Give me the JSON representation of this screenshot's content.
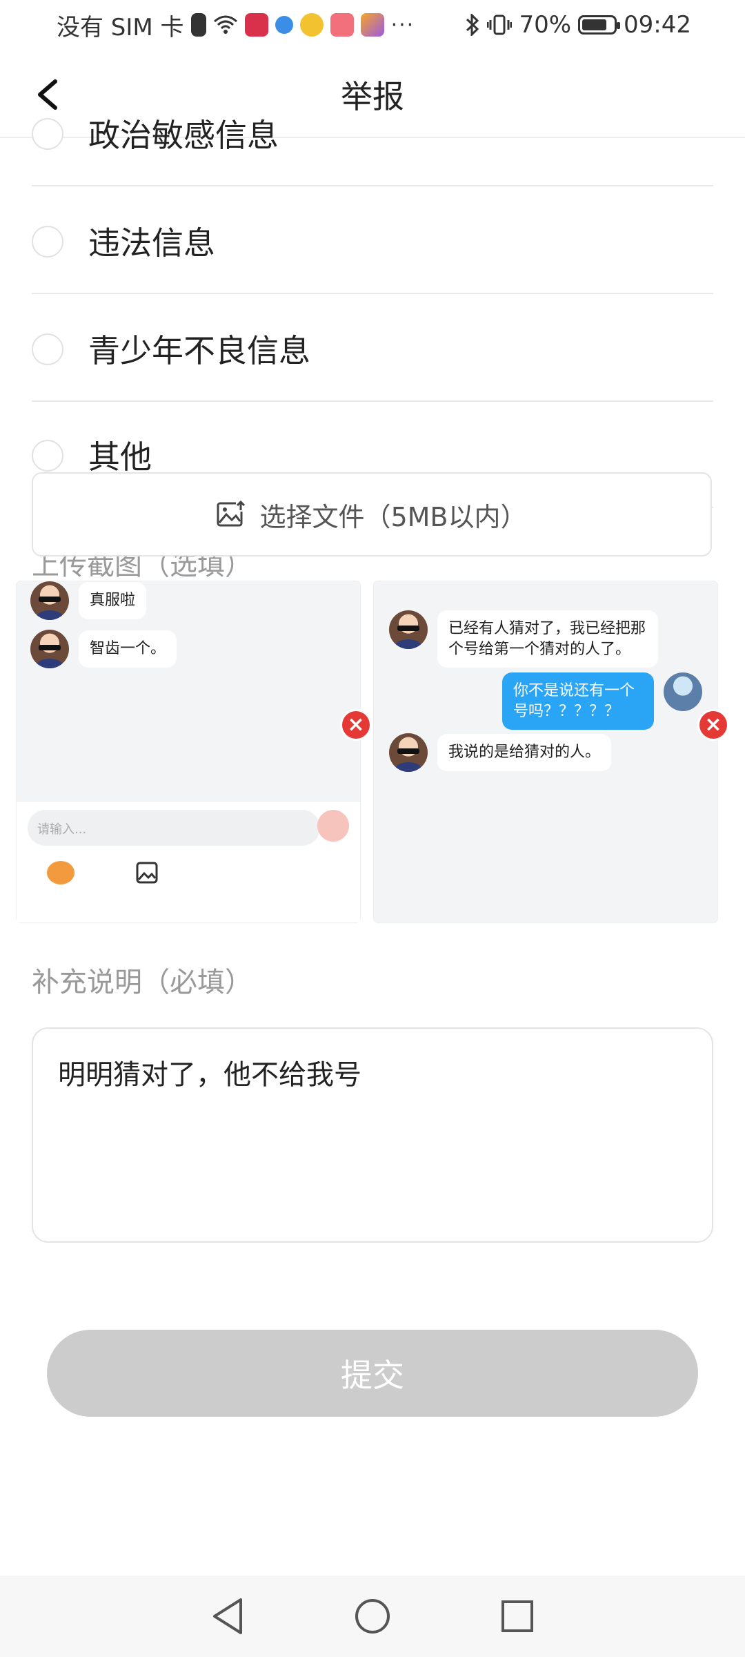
{
  "status_bar": {
    "carrier": "没有 SIM 卡",
    "more": "···",
    "battery": "70%",
    "time": "09:42"
  },
  "header": {
    "title": "举报"
  },
  "options": [
    {
      "label": "政治敏感信息"
    },
    {
      "label": "违法信息"
    },
    {
      "label": "青少年不良信息"
    },
    {
      "label": "其他"
    }
  ],
  "upload": {
    "label": "上传截图（选填）",
    "button": "选择文件（5MB以内）"
  },
  "screenshot1": {
    "msg1": "真服啦",
    "msg2": "智齿一个。",
    "input_placeholder": "请输入..."
  },
  "screenshot2": {
    "msg1": "已经有人猜对了，我已经把那个号给第一个猜对的人了。",
    "msg2": "你不是说还有一个号吗？？？？？",
    "msg3": "我说的是给猜对的人。"
  },
  "description": {
    "label": "补充说明（必填）",
    "value": "明明猜对了，他不给我号"
  },
  "submit": {
    "label": "提交"
  },
  "colors": {
    "accent_red": "#e53935",
    "bubble_blue": "#2aa4f4",
    "disabled_gray": "#cccccc"
  }
}
